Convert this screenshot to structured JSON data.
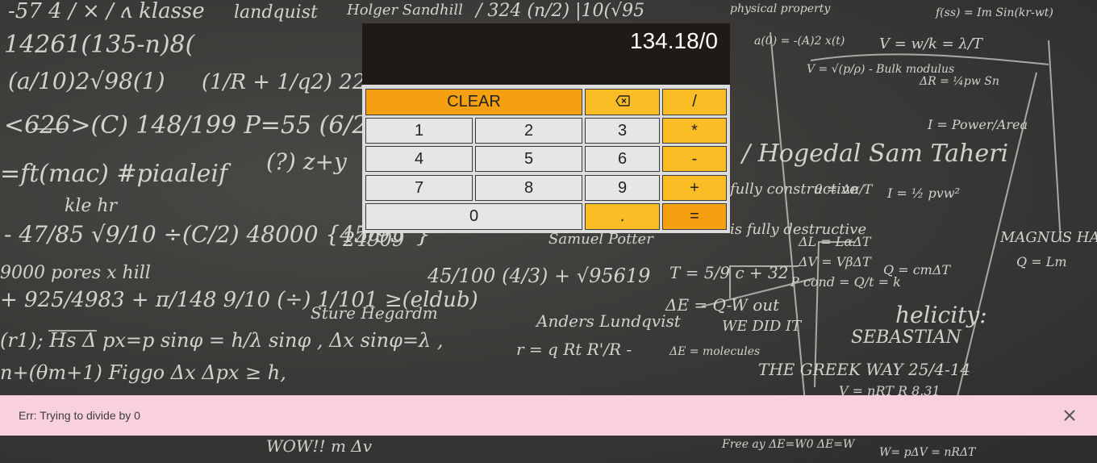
{
  "calculator": {
    "display": "134.18/0",
    "keys": {
      "clear": "CLEAR",
      "backspace": "backspace-icon",
      "divide": "/",
      "multiply": "*",
      "subtract": "-",
      "add": "+",
      "equals": "=",
      "decimal": ".",
      "one": "1",
      "two": "2",
      "three": "3",
      "four": "4",
      "five": "5",
      "six": "6",
      "seven": "7",
      "eight": "8",
      "nine": "9",
      "zero": "0"
    },
    "colors": {
      "display_bg": "#1e1a18",
      "number_key": "#e6e6e6",
      "operator_key": "#fbbd26",
      "clear_key": "#f4a012"
    }
  },
  "error": {
    "message": "Err: Trying to divide by 0",
    "close_icon": "close-icon",
    "bar_color": "#f9d0e0"
  }
}
